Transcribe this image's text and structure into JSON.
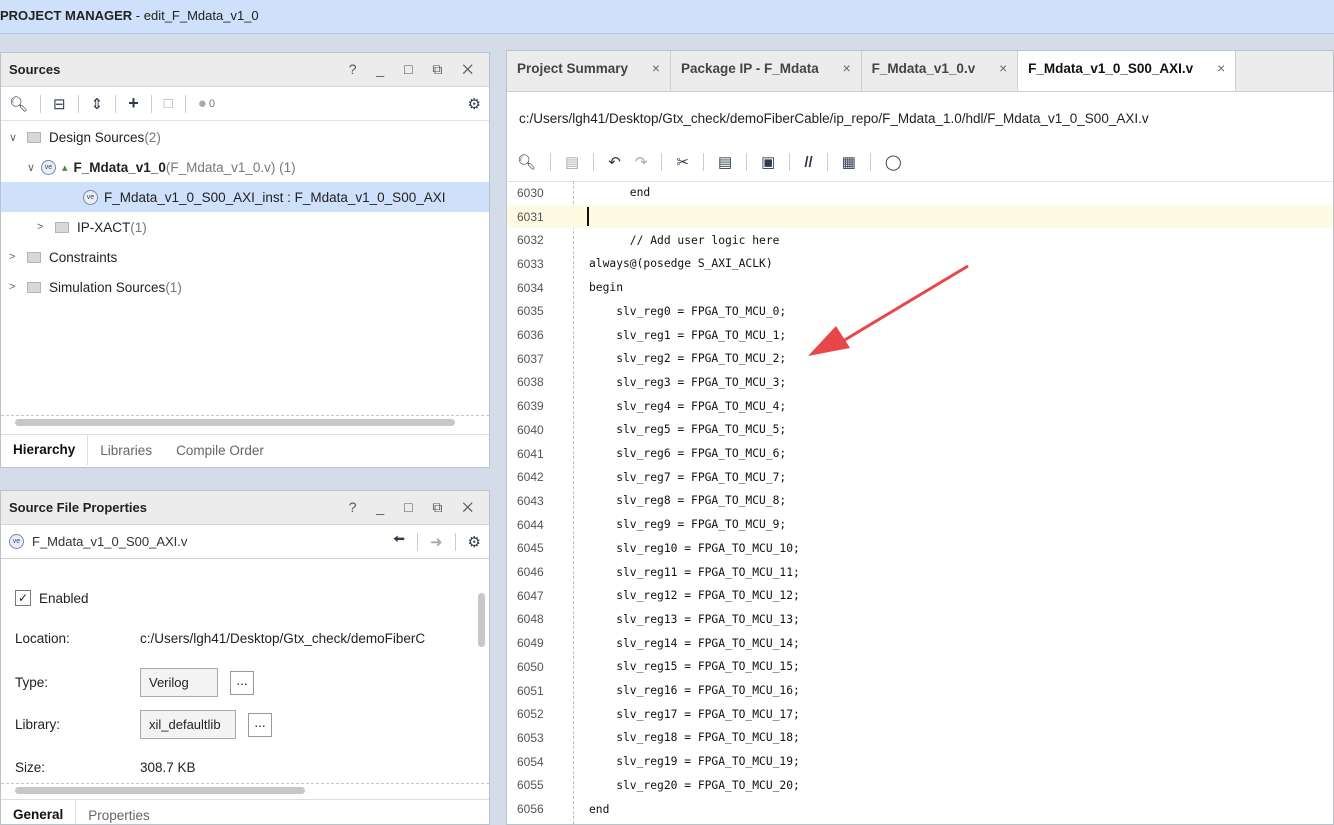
{
  "titlebar": {
    "prefix": "PROJECT MANAGER",
    "suffix": " - edit_F_Mdata_v1_0"
  },
  "sources": {
    "title": "Sources",
    "window_controls": "? _ □ ⧉ ✕",
    "count": "0",
    "tree": [
      {
        "label": "Design Sources",
        "extra": " (2)"
      },
      {
        "label": "F_Mdata_v1_0",
        "extra": " (F_Mdata_v1_0.v) (1)"
      },
      {
        "label": "F_Mdata_v1_0_S00_AXI_inst : F_Mdata_v1_0_S00_AXI",
        "extra": ""
      },
      {
        "label": "IP-XACT",
        "extra": " (1)"
      },
      {
        "label": "Constraints",
        "extra": ""
      },
      {
        "label": "Simulation Sources",
        "extra": " (1)"
      }
    ],
    "tabs": [
      "Hierarchy",
      "Libraries",
      "Compile Order"
    ]
  },
  "props": {
    "title": "Source File Properties",
    "window_controls": "? _ □ ⧉ ✕",
    "file": "F_Mdata_v1_0_S00_AXI.v",
    "enabled_label": "Enabled",
    "location_label": "Location:",
    "location_value": "c:/Users/lgh41/Desktop/Gtx_check/demoFiberC",
    "type_label": "Type:",
    "type_value": "Verilog",
    "library_label": "Library:",
    "library_value": "xil_defaultlib",
    "size_label": "Size:",
    "size_value": "308.7 KB",
    "dots": "...",
    "tabs": [
      "General",
      "Properties"
    ]
  },
  "editor": {
    "tabs": [
      {
        "label": "Project Summary"
      },
      {
        "label": "Package IP - F_Mdata"
      },
      {
        "label": "F_Mdata_v1_0.v"
      },
      {
        "label": "F_Mdata_v1_0_S00_AXI.v"
      }
    ],
    "path": "c:/Users/lgh41/Desktop/Gtx_check/demoFiberCable/ip_repo/F_Mdata_1.0/hdl/F_Mdata_v1_0_S00_AXI.v",
    "lines": [
      {
        "n": "6030",
        "t": "      end"
      },
      {
        "n": "6031",
        "t": ""
      },
      {
        "n": "6032",
        "t": "      // Add user logic here"
      },
      {
        "n": "6033",
        "t": "always@(posedge S_AXI_ACLK)"
      },
      {
        "n": "6034",
        "t": "begin"
      },
      {
        "n": "6035",
        "t": "    slv_reg0 = FPGA_TO_MCU_0;"
      },
      {
        "n": "6036",
        "t": "    slv_reg1 = FPGA_TO_MCU_1;"
      },
      {
        "n": "6037",
        "t": "    slv_reg2 = FPGA_TO_MCU_2;"
      },
      {
        "n": "6038",
        "t": "    slv_reg3 = FPGA_TO_MCU_3;"
      },
      {
        "n": "6039",
        "t": "    slv_reg4 = FPGA_TO_MCU_4;"
      },
      {
        "n": "6040",
        "t": "    slv_reg5 = FPGA_TO_MCU_5;"
      },
      {
        "n": "6041",
        "t": "    slv_reg6 = FPGA_TO_MCU_6;"
      },
      {
        "n": "6042",
        "t": "    slv_reg7 = FPGA_TO_MCU_7;"
      },
      {
        "n": "6043",
        "t": "    slv_reg8 = FPGA_TO_MCU_8;"
      },
      {
        "n": "6044",
        "t": "    slv_reg9 = FPGA_TO_MCU_9;"
      },
      {
        "n": "6045",
        "t": "    slv_reg10 = FPGA_TO_MCU_10;"
      },
      {
        "n": "6046",
        "t": "    slv_reg11 = FPGA_TO_MCU_11;"
      },
      {
        "n": "6047",
        "t": "    slv_reg12 = FPGA_TO_MCU_12;"
      },
      {
        "n": "6048",
        "t": "    slv_reg13 = FPGA_TO_MCU_13;"
      },
      {
        "n": "6049",
        "t": "    slv_reg14 = FPGA_TO_MCU_14;"
      },
      {
        "n": "6050",
        "t": "    slv_reg15 = FPGA_TO_MCU_15;"
      },
      {
        "n": "6051",
        "t": "    slv_reg16 = FPGA_TO_MCU_16;"
      },
      {
        "n": "6052",
        "t": "    slv_reg17 = FPGA_TO_MCU_17;"
      },
      {
        "n": "6053",
        "t": "    slv_reg18 = FPGA_TO_MCU_18;"
      },
      {
        "n": "6054",
        "t": "    slv_reg19 = FPGA_TO_MCU_19;"
      },
      {
        "n": "6055",
        "t": "    slv_reg20 = FPGA_TO_MCU_20;"
      },
      {
        "n": "6056",
        "t": "end"
      }
    ],
    "current_line": "6031"
  },
  "colors": {
    "arrow": "#e8474a",
    "selection": "#cfe0fb"
  }
}
